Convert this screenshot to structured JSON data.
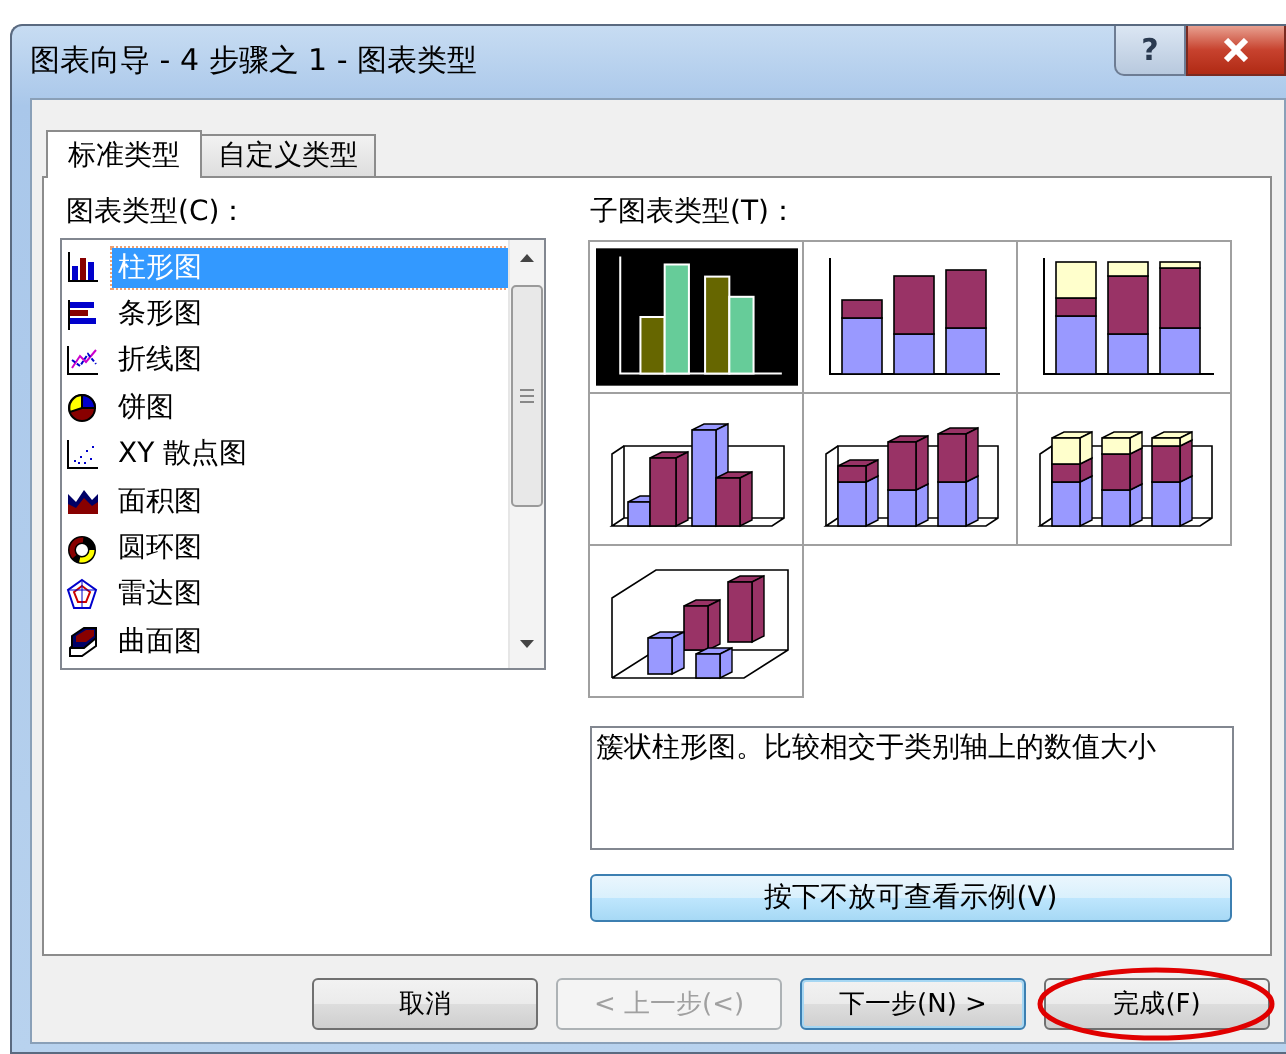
{
  "window": {
    "title": "图表向导 - 4 步骤之 1 - 图表类型",
    "help_button": "?"
  },
  "tabs": [
    {
      "label": "标准类型",
      "selected": true
    },
    {
      "label": "自定义类型",
      "selected": false
    }
  ],
  "chart_types": {
    "label": "图表类型(C)：",
    "items": [
      {
        "label": "柱形图",
        "kind": "column",
        "selected": true
      },
      {
        "label": "条形图",
        "kind": "bar",
        "selected": false
      },
      {
        "label": "折线图",
        "kind": "line",
        "selected": false
      },
      {
        "label": "饼图",
        "kind": "pie",
        "selected": false
      },
      {
        "label": "XY 散点图",
        "kind": "scatter",
        "selected": false
      },
      {
        "label": "面积图",
        "kind": "area",
        "selected": false
      },
      {
        "label": "圆环图",
        "kind": "donut",
        "selected": false
      },
      {
        "label": "雷达图",
        "kind": "radar",
        "selected": false
      },
      {
        "label": "曲面图",
        "kind": "surface",
        "selected": false
      }
    ]
  },
  "subtypes": {
    "label": "子图表类型(T)：",
    "items": [
      {
        "kind": "clustered",
        "selected": true
      },
      {
        "kind": "stacked",
        "selected": false
      },
      {
        "kind": "percent",
        "selected": false
      },
      {
        "kind": "clustered3d",
        "selected": false
      },
      {
        "kind": "stacked3d",
        "selected": false
      },
      {
        "kind": "percent3d",
        "selected": false
      },
      {
        "kind": "column3d",
        "selected": false
      }
    ]
  },
  "description": "簇状柱形图。比较相交于类别轴上的数值大小",
  "preview_button": {
    "label": "按下不放可查看示例(V)"
  },
  "buttons": [
    {
      "label": "取消",
      "disabled": false,
      "default": false,
      "circled": false
    },
    {
      "label": "< 上一步(<)",
      "disabled": true,
      "default": false,
      "circled": false
    },
    {
      "label": "下一步(N) >",
      "disabled": false,
      "default": true,
      "circled": false
    },
    {
      "label": "完成(F)",
      "disabled": false,
      "default": false,
      "circled": true
    }
  ]
}
